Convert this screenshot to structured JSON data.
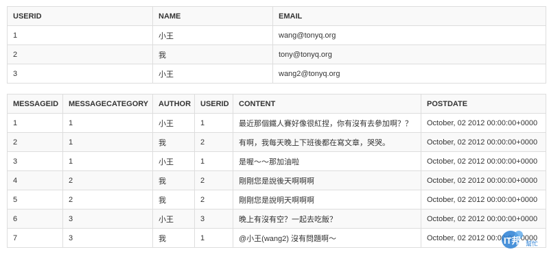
{
  "users_table": {
    "headers": [
      "USERID",
      "NAME",
      "EMAIL"
    ],
    "rows": [
      [
        "1",
        "小王",
        "wang@tonyq.org"
      ],
      [
        "2",
        "我",
        "tony@tonyq.org"
      ],
      [
        "3",
        "小王",
        "wang2@tonyq.org"
      ]
    ]
  },
  "messages_table": {
    "headers": [
      "MESSAGEID",
      "MESSAGECATEGORY",
      "AUTHOR",
      "USERID",
      "CONTENT",
      "POSTDATE"
    ],
    "rows": [
      [
        "1",
        "1",
        "小王",
        "1",
        "最近那個鐵人賽好像很紅捏，你有沒有去參加啊？？",
        "October, 02 2012 00:00:00+0000"
      ],
      [
        "2",
        "1",
        "我",
        "2",
        "有啊，我每天晚上下班後都在寫文章，哭哭。",
        "October, 02 2012 00:00:00+0000"
      ],
      [
        "3",
        "1",
        "小王",
        "1",
        "是喔～～那加油啦",
        "October, 02 2012 00:00:00+0000"
      ],
      [
        "4",
        "2",
        "我",
        "2",
        "剛剛您是說後天啊啊啊",
        "October, 02 2012 00:00:00+0000"
      ],
      [
        "5",
        "2",
        "我",
        "2",
        "剛剛您是說明天啊啊啊",
        "October, 02 2012 00:00:00+0000"
      ],
      [
        "6",
        "3",
        "小王",
        "3",
        "晚上有沒有空？一起去吃飯？",
        "October, 02 2012 00:00:00+0000"
      ],
      [
        "7",
        "3",
        "我",
        "1",
        "@小王(wang2) 沒有問題啊～",
        "October, 02 2012 00:00:00+0000"
      ]
    ]
  },
  "watermark": {
    "logo_text": "IT邦",
    "logo_subtext": "幫忙",
    "colors": {
      "primary": "#2a7fd4",
      "accent": "#ffffff"
    }
  }
}
